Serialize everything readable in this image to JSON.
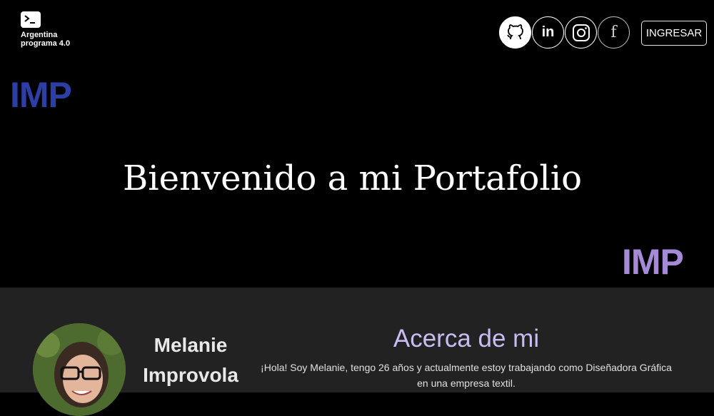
{
  "header": {
    "brand_text": "Argentina programa 4.0",
    "imp_logo_text": "IMP",
    "login_label": "INGRESAR",
    "social": [
      {
        "name": "github"
      },
      {
        "name": "linkedin",
        "label": "in"
      },
      {
        "name": "instagram"
      },
      {
        "name": "facebook",
        "label": "f"
      }
    ]
  },
  "hero": {
    "title": "Bienvenido a mi Portafolio"
  },
  "about": {
    "name": "Melanie Improvola",
    "title": "Acerca de mi",
    "text": "¡Hola! Soy Melanie, tengo 26 años y actualmente estoy trabajando como Diseñadora Gráfica en una empresa textil."
  },
  "colors": {
    "imp_top": "#2d3ea6",
    "imp_bottom": "#a58ad6",
    "about_title": "#c9bcf0",
    "about_bg": "#222223"
  }
}
